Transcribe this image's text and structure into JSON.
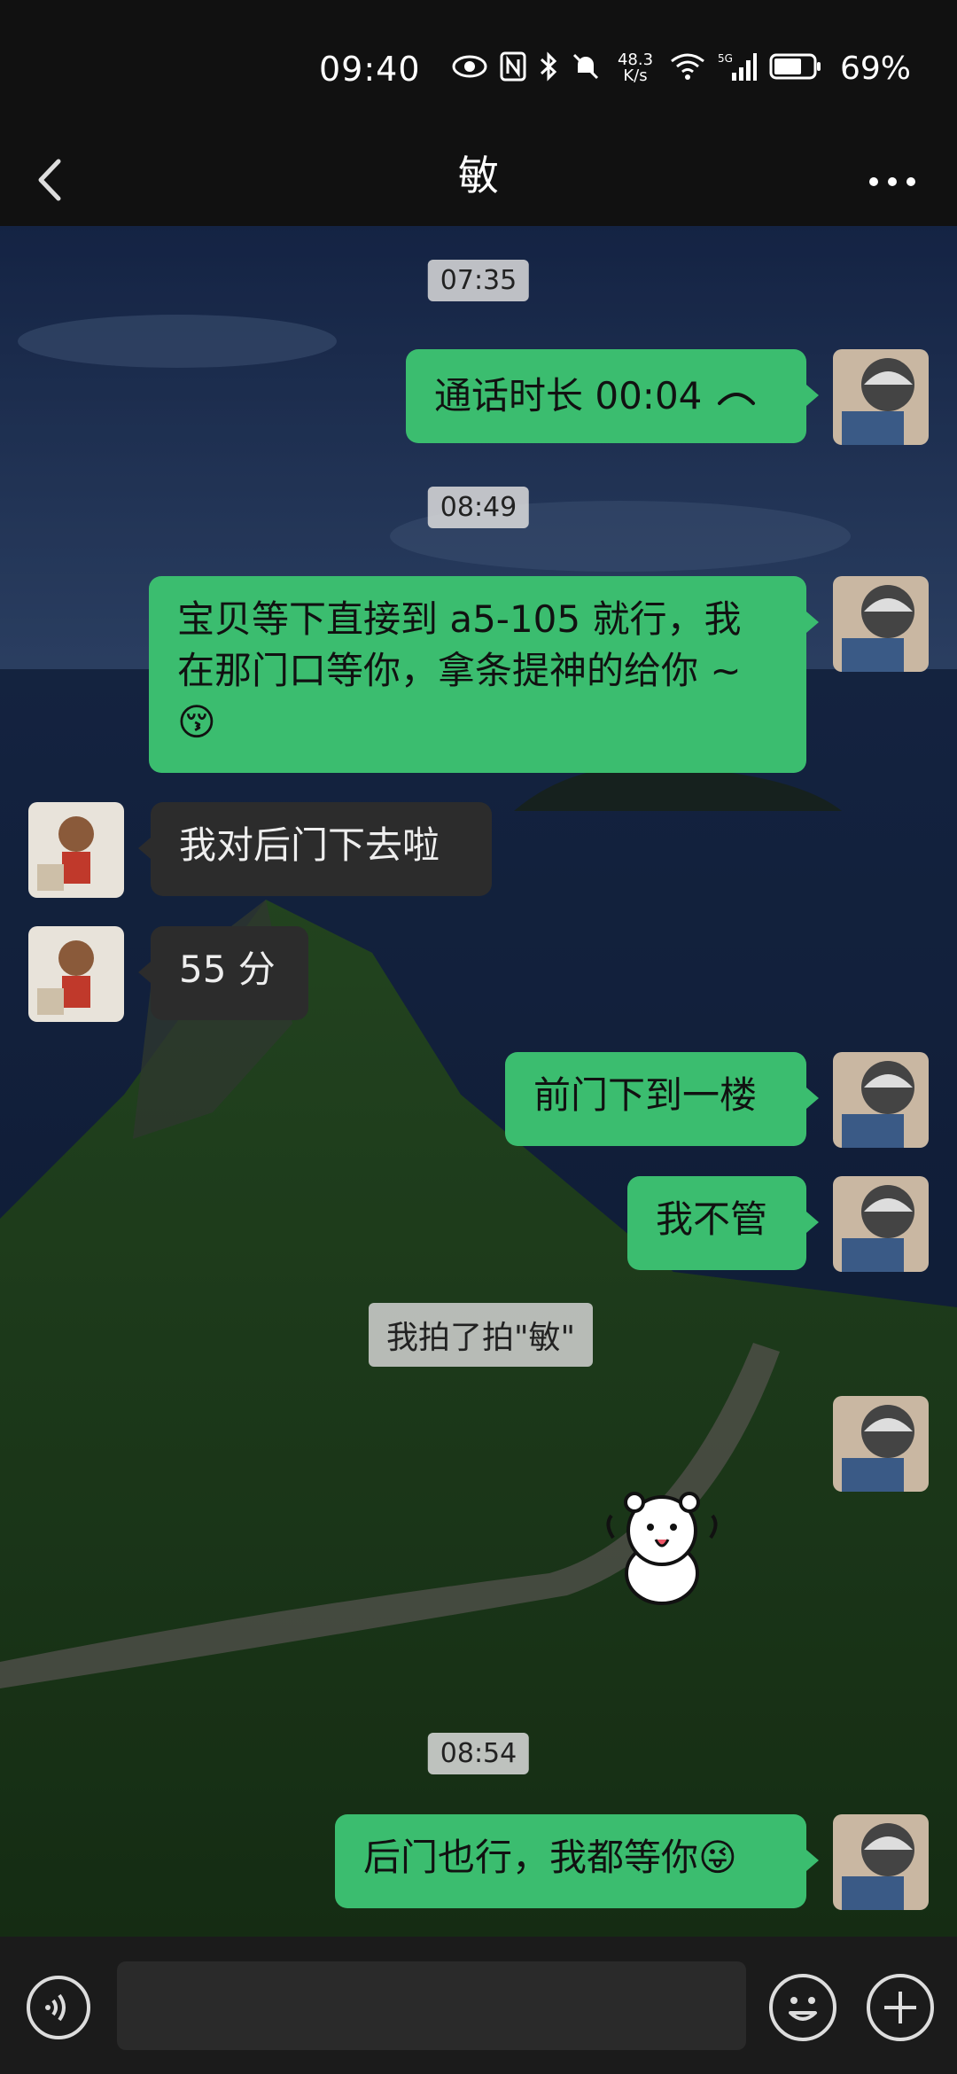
{
  "status_bar": {
    "time": "09:40",
    "net_speed_value": "48.3",
    "net_speed_unit": "K/s",
    "network": "5G",
    "battery": "69%"
  },
  "header": {
    "title": "敏"
  },
  "messages": [
    {
      "type": "time",
      "text": "07:35"
    },
    {
      "type": "sent",
      "text": "通话时长 00:04"
    },
    {
      "type": "time",
      "text": "08:49"
    },
    {
      "type": "sent",
      "text": "宝贝等下直接到 a5-105 就行，我在那门口等你，拿条提神的给你 ~😚"
    },
    {
      "type": "received",
      "text": "我对后门下去啦"
    },
    {
      "type": "received",
      "text": "55 分"
    },
    {
      "type": "sent",
      "text": "前门下到一楼"
    },
    {
      "type": "sent",
      "text": "我不管"
    },
    {
      "type": "system",
      "text": "我拍了拍\"敏\""
    },
    {
      "type": "sticker",
      "text": ""
    },
    {
      "type": "time",
      "text": "08:54"
    },
    {
      "type": "sent",
      "text": "后门也行，我都等你😜"
    }
  ],
  "colors": {
    "sent_bubble": "#3bbd6f",
    "received_bubble": "#2c2c2c",
    "header_bg": "#111111"
  },
  "icons": {
    "back": "chevron-left-icon",
    "more": "more-dots-icon",
    "voice": "voice-icon",
    "emoji": "emoji-icon",
    "plus": "plus-icon",
    "call": "call-end-icon"
  }
}
